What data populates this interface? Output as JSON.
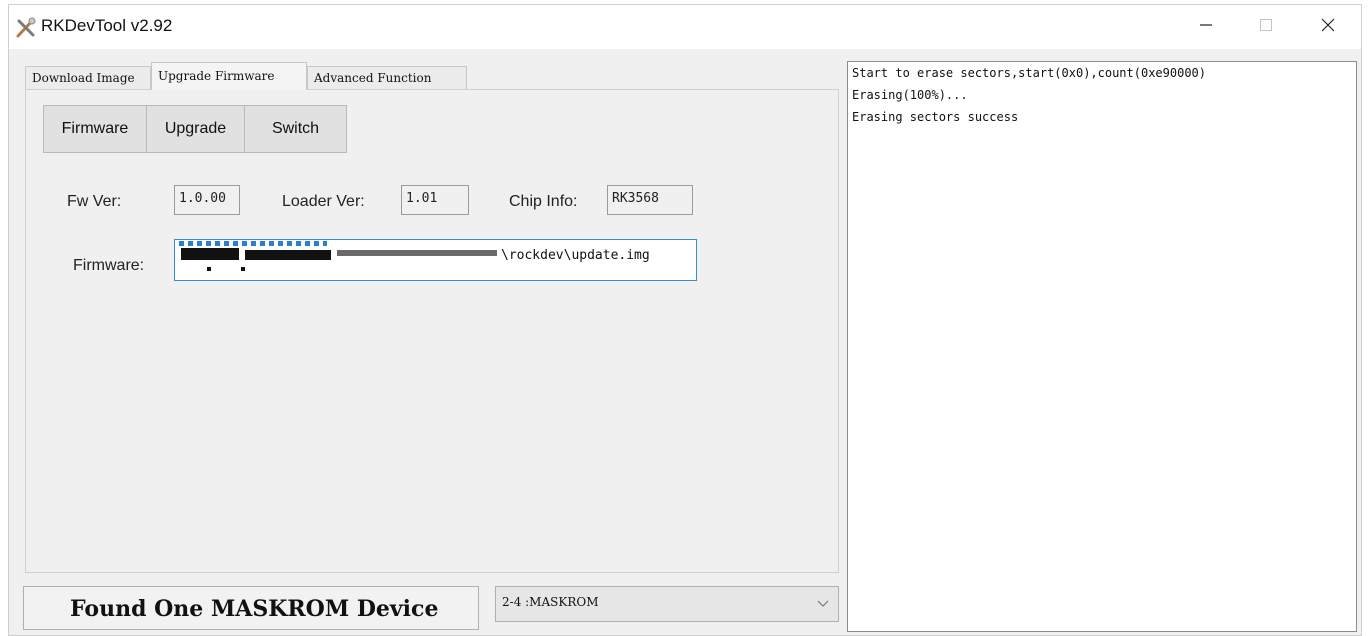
{
  "window": {
    "title": "RKDevTool v2.92",
    "icons": {
      "app": "rk-tool-icon",
      "minimize": "minimize-icon",
      "maximize": "maximize-icon",
      "close": "close-icon"
    }
  },
  "tabs": [
    {
      "label": "Download Image",
      "active": false
    },
    {
      "label": "Upgrade Firmware",
      "active": true
    },
    {
      "label": "Advanced Function",
      "active": false
    }
  ],
  "toolbar": {
    "firmware_label": "Firmware",
    "upgrade_label": "Upgrade",
    "switch_label": "Switch"
  },
  "info": {
    "fw_ver_label": "Fw Ver:",
    "fw_ver_value": "1.0.00",
    "loader_ver_label": "Loader Ver:",
    "loader_ver_value": "1.01",
    "chip_info_label": "Chip Info:",
    "chip_info_value": "RK3568"
  },
  "firmware_path": {
    "label": "Firmware:",
    "value_visible": "\\rockdev\\update.img"
  },
  "status": {
    "message": "Found One MASKROM Device",
    "device_selected": "2-4 :MASKROM"
  },
  "log": {
    "lines": [
      "Start to erase sectors,start(0x0),count(0xe90000)",
      "Erasing(100%)...",
      "Erasing sectors success"
    ]
  },
  "colors": {
    "window_bg": "#f0f0f0",
    "focus_border": "#2f8fd1",
    "button_bg": "#e1e1e1"
  }
}
